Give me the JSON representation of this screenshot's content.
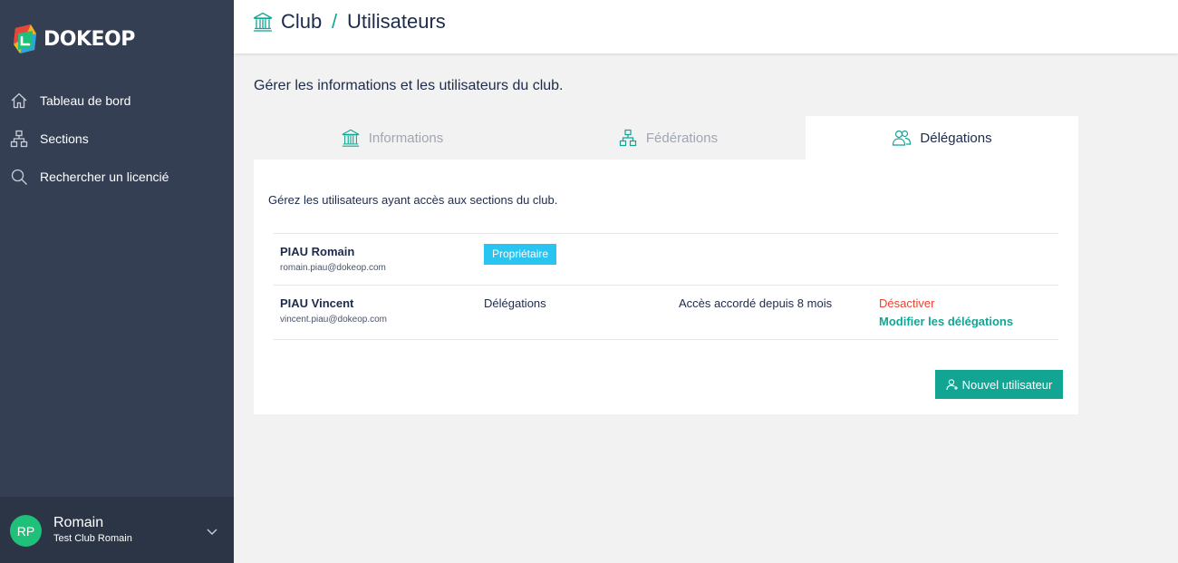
{
  "brand": {
    "name": "DOKEOP",
    "accent": "#12a594"
  },
  "sidebar": {
    "items": [
      {
        "label": "Tableau de bord",
        "icon": "home-icon"
      },
      {
        "label": "Sections",
        "icon": "sitemap-icon"
      },
      {
        "label": "Rechercher un licencié",
        "icon": "search-icon"
      }
    ],
    "user": {
      "initials": "RP",
      "name": "Romain",
      "club": "Test Club Romain"
    }
  },
  "header": {
    "section": "Club",
    "separator": "/",
    "page": "Utilisateurs"
  },
  "main": {
    "description": "Gérer les informations et les utilisateurs du club.",
    "tabs": [
      {
        "label": "Informations",
        "icon": "bank-icon",
        "active": false
      },
      {
        "label": "Fédérations",
        "icon": "sitemap-icon",
        "active": false
      },
      {
        "label": "Délégations",
        "icon": "users-icon",
        "active": true
      }
    ],
    "card_description": "Gérez les utilisateurs ayant accès aux sections du club.",
    "users": [
      {
        "name": "PIAU Romain",
        "email": "romain.piau@dokeop.com",
        "badge": "Propriétaire"
      },
      {
        "name": "PIAU Vincent",
        "email": "vincent.piau@dokeop.com",
        "role": "Délégations",
        "access": "Accès accordé depuis 8 mois",
        "deactivate": "Désactiver",
        "modify": "Modifier les délégations"
      }
    ],
    "new_user_button": "Nouvel utilisateur"
  }
}
